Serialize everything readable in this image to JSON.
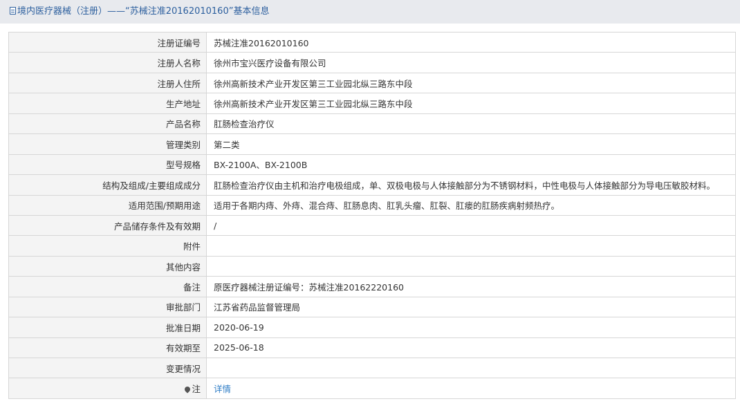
{
  "header": {
    "title": "境内医疗器械（注册）——“苏械注准20162010160”基本信息"
  },
  "rows": [
    {
      "label": "注册证编号",
      "value": "苏械注准20162010160"
    },
    {
      "label": "注册人名称",
      "value": "徐州市宝兴医疗设备有限公司"
    },
    {
      "label": "注册人住所",
      "value": "徐州高新技术产业开发区第三工业园北纵三路东中段"
    },
    {
      "label": "生产地址",
      "value": "徐州高新技术产业开发区第三工业园北纵三路东中段"
    },
    {
      "label": "产品名称",
      "value": "肛肠检查治疗仪"
    },
    {
      "label": "管理类别",
      "value": "第二类"
    },
    {
      "label": "型号规格",
      "value": "BX-2100A、BX-2100B"
    },
    {
      "label": "结构及组成/主要组成成分",
      "value": "肛肠检查治疗仪由主机和治疗电极组成，单、双极电极与人体接触部分为不锈钢材料，中性电极与人体接触部分为导电压敏胶材料。"
    },
    {
      "label": "适用范围/预期用途",
      "value": "适用于各期内痔、外痔、混合痔、肛肠息肉、肛乳头瘤、肛裂、肛瘘的肛肠疾病射频热疗。"
    },
    {
      "label": "产品储存条件及有效期",
      "value": "/"
    },
    {
      "label": "附件",
      "value": ""
    },
    {
      "label": "其他内容",
      "value": ""
    },
    {
      "label": "备注",
      "value": "原医疗器械注册证编号：苏械注准20162220160"
    },
    {
      "label": "审批部门",
      "value": "江苏省药品监督管理局"
    },
    {
      "label": "批准日期",
      "value": "2020-06-19"
    },
    {
      "label": "有效期至",
      "value": "2025-06-18"
    },
    {
      "label": "变更情况",
      "value": ""
    }
  ],
  "note": {
    "label": "注",
    "link_text": "详情",
    "icon": "pin-icon"
  }
}
